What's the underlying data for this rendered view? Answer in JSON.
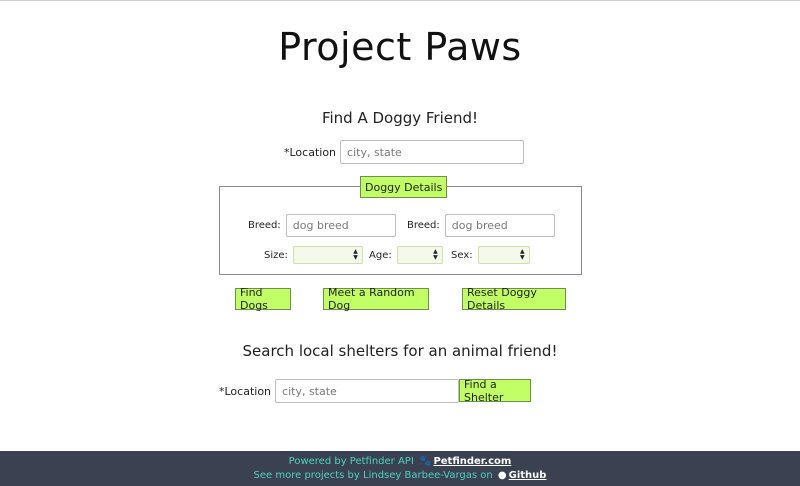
{
  "header": {
    "title": "Project Paws"
  },
  "dog_search": {
    "subtitle": "Find A Doggy Friend!",
    "location_label": "*Location",
    "location_placeholder": "city, state",
    "details_legend": "Doggy Details",
    "breed1_label": "Breed:",
    "breed1_placeholder": "dog breed",
    "breed2_label": "Breed:",
    "breed2_placeholder": "dog breed",
    "size_label": "Size:",
    "size_value": "",
    "age_label": "Age:",
    "age_value": "",
    "sex_label": "Sex:",
    "sex_value": "",
    "find_dogs_label": "Find Dogs",
    "random_dog_label": "Meet a Random Dog",
    "reset_label": "Reset Doggy Details"
  },
  "shelter_search": {
    "heading": "Search local shelters for an animal friend!",
    "location_label": "*Location",
    "location_placeholder": "city, state",
    "find_shelter_label": "Find a Shelter"
  },
  "footer": {
    "powered_text": "Powered by Petfinder API",
    "petfinder_link": "Petfinder.com",
    "more_text": "See more projects by Lindsey Barbee-Vargas on",
    "github_link": "Github"
  },
  "colors": {
    "button_bg": "#c2ff66",
    "footer_bg": "#3a4150",
    "footer_text": "#4fd1c5"
  },
  "icons": [
    "paw-icon",
    "github-icon",
    "select-arrows-icon"
  ]
}
